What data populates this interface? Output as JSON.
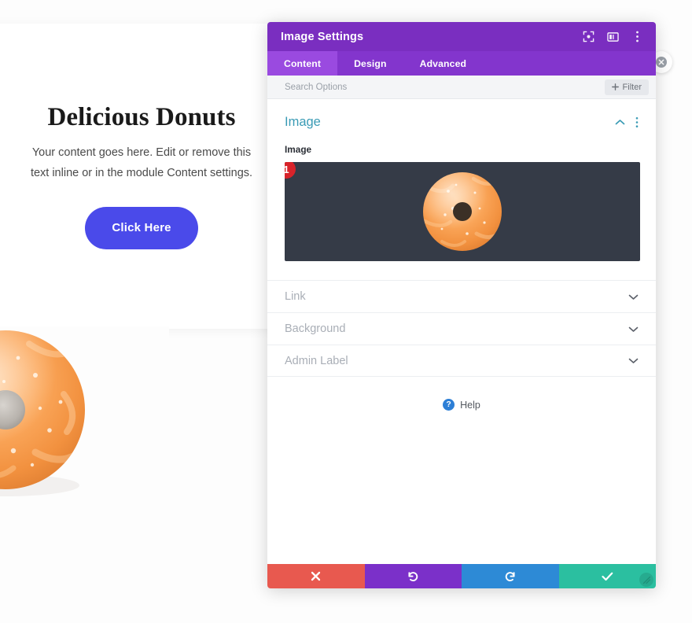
{
  "page": {
    "headline": "Delicious Donuts",
    "body_text": "Your content goes here. Edit or remove this text inline or in the module Content settings.",
    "cta_label": "Click Here",
    "cta_color": "#4a4aea",
    "photo_alt": "glazed-donut-photo"
  },
  "panel": {
    "title": "Image Settings",
    "titlebar_color": "#7a2ec0",
    "tabbar_color": "#8335cd",
    "titlebar_icons": [
      {
        "name": "fullscreen-icon"
      },
      {
        "name": "layout-columns-icon"
      },
      {
        "name": "more-vertical-icon"
      }
    ],
    "tabs": [
      {
        "label": "Content",
        "active": true
      },
      {
        "label": "Design",
        "active": false
      },
      {
        "label": "Advanced",
        "active": false
      }
    ],
    "search": {
      "placeholder": "Search Options",
      "value": ""
    },
    "filter_label": "Filter",
    "section": {
      "title": "Image",
      "title_color": "#3a9bb5",
      "field_label": "Image",
      "preview_bg": "#353b47",
      "step_badge": "1",
      "step_badge_color": "#d8232a",
      "collapse_icon": "chevron-up-icon",
      "more_icon": "more-vertical-icon"
    },
    "collapsed_sections": [
      {
        "label": "Link",
        "icon": "chevron-down-icon"
      },
      {
        "label": "Background",
        "icon": "chevron-down-icon"
      },
      {
        "label": "Admin Label",
        "icon": "chevron-down-icon"
      }
    ],
    "help": {
      "label": "Help",
      "icon": "question-circle-icon",
      "icon_color": "#2d7fd6"
    },
    "footer_buttons": [
      {
        "name": "cancel-button",
        "icon": "close-x-icon",
        "color": "#e8594f"
      },
      {
        "name": "undo-button",
        "icon": "undo-arrow-icon",
        "color": "#7b30c9"
      },
      {
        "name": "redo-button",
        "icon": "redo-arrow-icon",
        "color": "#2d8ad6"
      },
      {
        "name": "save-button",
        "icon": "checkmark-icon",
        "color": "#2bbfa0"
      }
    ],
    "resize_handle_icon": "resize-grip-icon"
  },
  "floating": {
    "close_icon": "close-circle-icon"
  }
}
